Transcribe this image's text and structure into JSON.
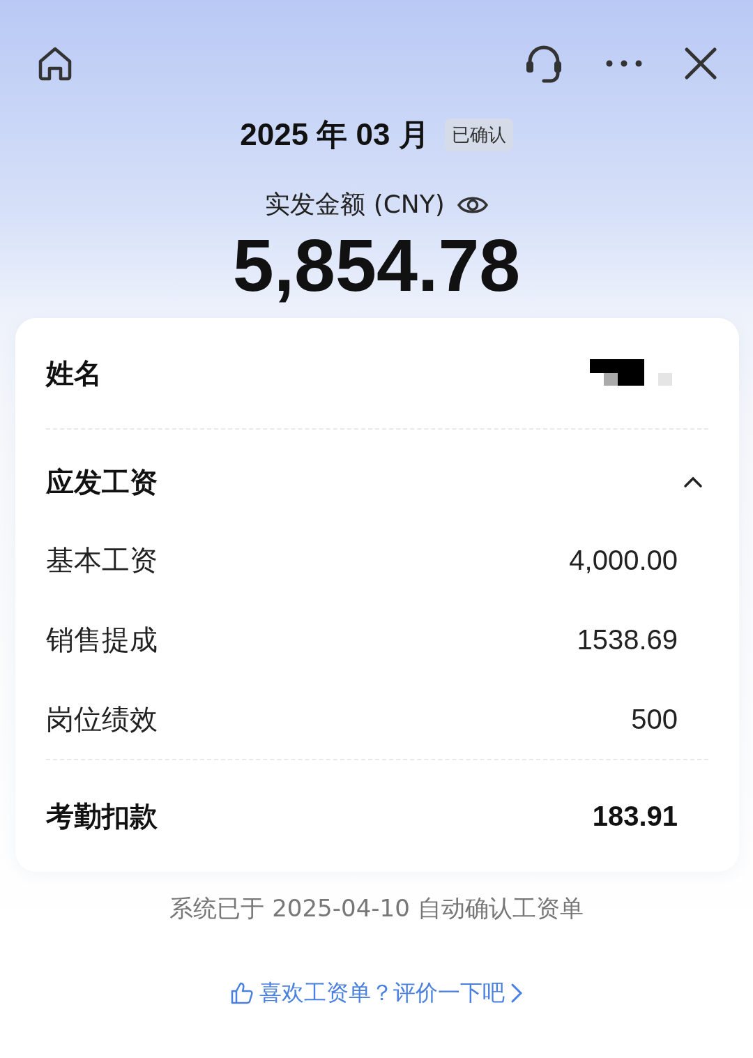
{
  "period": {
    "title": "2025 年 03 月",
    "status_badge": "已确认"
  },
  "net_pay": {
    "label": "实发金额 (CNY)",
    "amount": "5,854.78"
  },
  "card": {
    "name_label": "姓名",
    "groups": [
      {
        "label": "应发工资",
        "expanded": true,
        "items": [
          {
            "label": "基本工资",
            "value": "4,000.00"
          },
          {
            "label": "销售提成",
            "value": "1538.69"
          },
          {
            "label": "岗位绩效",
            "value": "500"
          }
        ]
      }
    ],
    "deduction": {
      "label": "考勤扣款",
      "value": "183.91"
    }
  },
  "footer_note": "系统已于 2025-04-10 自动确认工资单",
  "feedback_link": "喜欢工资单？评价一下吧"
}
